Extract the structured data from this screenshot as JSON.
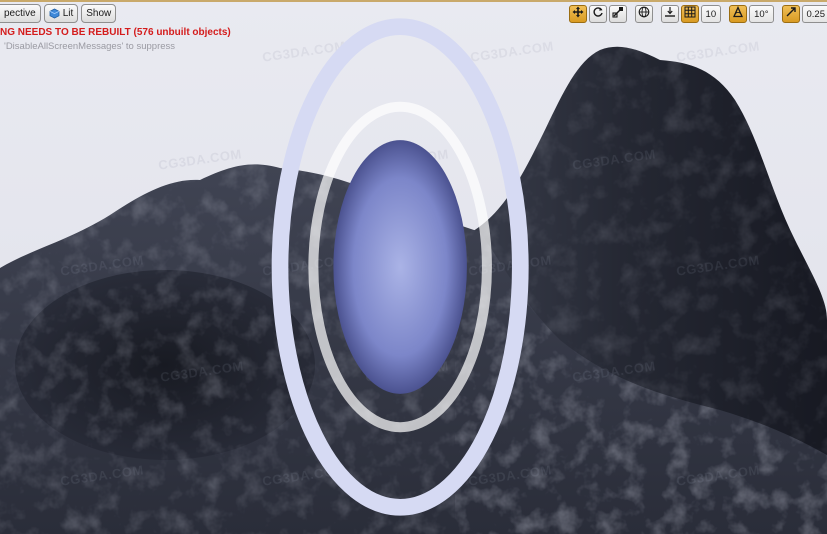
{
  "toolbar_left": {
    "perspective_label": "pective",
    "lit_label": "Lit",
    "show_label": "Show"
  },
  "messages": {
    "error": "NG NEEDS TO BE REBUILT (576 unbuilt objects)",
    "hint": "'DisableAllScreenMessages' to suppress"
  },
  "toolbar_right": {
    "icons": [
      "move-icon",
      "rotate-icon",
      "scale-icon",
      "world-icon",
      "surface-snap-icon",
      "grid-snap-icon",
      "angle-snap-icon",
      "scale-snap-icon"
    ],
    "grid_snap_value": "10",
    "angle_snap_value": "10°",
    "scale_snap_value": "0.25"
  },
  "watermark_text": "CG3DA.COM",
  "colors": {
    "accent": "#e0a83a",
    "error_text": "#d41c1c",
    "sky": "#e6e7ee",
    "terrain": "#2b2e3a"
  }
}
